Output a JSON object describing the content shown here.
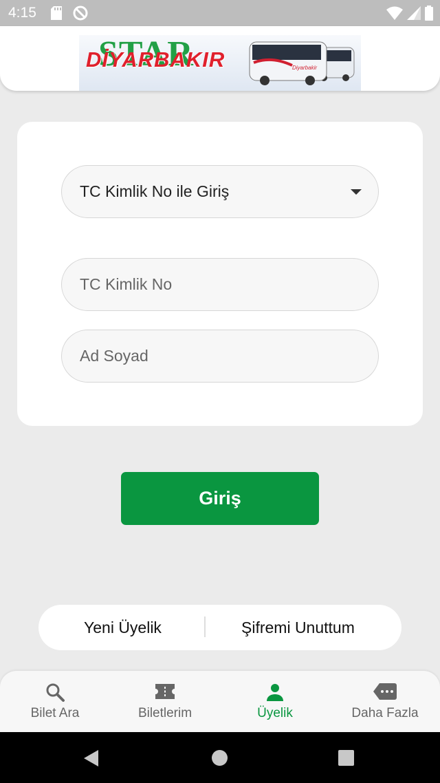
{
  "status": {
    "time": "4:15",
    "icons": [
      "sd-card-icon",
      "do-not-disturb-icon",
      "wifi-icon",
      "signal-icon",
      "battery-icon"
    ]
  },
  "header": {
    "logo_star": "STAR",
    "logo_text": "DİYARBAKIR",
    "logo_bus_brand": "Diyarbakir",
    "brand_colors": {
      "green": "#22a046",
      "red": "#e0202c"
    }
  },
  "form": {
    "login_type_selected": "TC Kimlik No ile Giriş",
    "tc_placeholder": "TC Kimlik No",
    "name_placeholder": "Ad Soyad"
  },
  "login_button": "Giriş",
  "links": {
    "new_member": "Yeni Üyelik",
    "forgot_password": "Şifremi Unuttum"
  },
  "bottom_nav": {
    "items": [
      {
        "label": "Bilet Ara",
        "icon": "search-icon"
      },
      {
        "label": "Biletlerim",
        "icon": "ticket-icon"
      },
      {
        "label": "Üyelik",
        "icon": "person-icon"
      },
      {
        "label": "Daha Fazla",
        "icon": "more-chat-icon"
      }
    ],
    "active_index": 2,
    "accent_color": "#0a9640"
  }
}
